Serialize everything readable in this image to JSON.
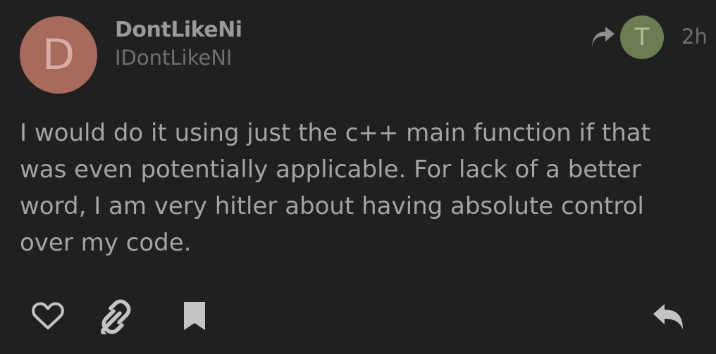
{
  "post": {
    "author": {
      "avatar_initial": "D",
      "display_name": "DontLikeNi",
      "username": "IDontLikeNI"
    },
    "reply_to": {
      "avatar_initial": "T"
    },
    "timestamp": "2h",
    "body": "I would do it using just the c++ main function if that was even potentially applicable. For lack of a better word, I am very hitler about having absolute control over my code."
  },
  "actions": [
    {
      "icon": "heart-icon"
    },
    {
      "icon": "link-icon"
    },
    {
      "icon": "bookmark-icon"
    },
    {
      "icon": "reply-icon"
    }
  ],
  "colors": {
    "background": "#202020",
    "author_avatar": "#a86a5d",
    "reply_avatar": "#6c7e51",
    "primary_text": "#a4a4a4",
    "secondary_text": "#6f6f6f",
    "icon": "#c4c4c4"
  }
}
